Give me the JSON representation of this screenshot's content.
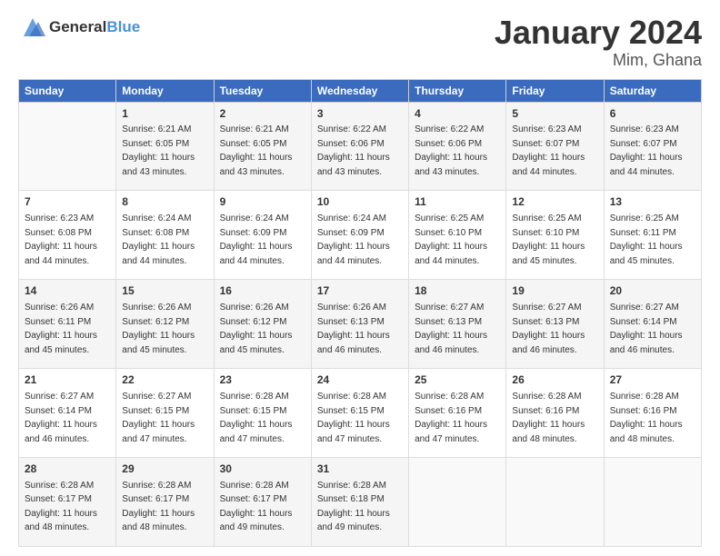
{
  "logo": {
    "general": "General",
    "blue": "Blue"
  },
  "title": "January 2024",
  "subtitle": "Mim, Ghana",
  "days_header": [
    "Sunday",
    "Monday",
    "Tuesday",
    "Wednesday",
    "Thursday",
    "Friday",
    "Saturday"
  ],
  "weeks": [
    [
      {
        "day": "",
        "info": ""
      },
      {
        "day": "1",
        "info": "Sunrise: 6:21 AM\nSunset: 6:05 PM\nDaylight: 11 hours\nand 43 minutes."
      },
      {
        "day": "2",
        "info": "Sunrise: 6:21 AM\nSunset: 6:05 PM\nDaylight: 11 hours\nand 43 minutes."
      },
      {
        "day": "3",
        "info": "Sunrise: 6:22 AM\nSunset: 6:06 PM\nDaylight: 11 hours\nand 43 minutes."
      },
      {
        "day": "4",
        "info": "Sunrise: 6:22 AM\nSunset: 6:06 PM\nDaylight: 11 hours\nand 43 minutes."
      },
      {
        "day": "5",
        "info": "Sunrise: 6:23 AM\nSunset: 6:07 PM\nDaylight: 11 hours\nand 44 minutes."
      },
      {
        "day": "6",
        "info": "Sunrise: 6:23 AM\nSunset: 6:07 PM\nDaylight: 11 hours\nand 44 minutes."
      }
    ],
    [
      {
        "day": "7",
        "info": "Sunrise: 6:23 AM\nSunset: 6:08 PM\nDaylight: 11 hours\nand 44 minutes."
      },
      {
        "day": "8",
        "info": "Sunrise: 6:24 AM\nSunset: 6:08 PM\nDaylight: 11 hours\nand 44 minutes."
      },
      {
        "day": "9",
        "info": "Sunrise: 6:24 AM\nSunset: 6:09 PM\nDaylight: 11 hours\nand 44 minutes."
      },
      {
        "day": "10",
        "info": "Sunrise: 6:24 AM\nSunset: 6:09 PM\nDaylight: 11 hours\nand 44 minutes."
      },
      {
        "day": "11",
        "info": "Sunrise: 6:25 AM\nSunset: 6:10 PM\nDaylight: 11 hours\nand 44 minutes."
      },
      {
        "day": "12",
        "info": "Sunrise: 6:25 AM\nSunset: 6:10 PM\nDaylight: 11 hours\nand 45 minutes."
      },
      {
        "day": "13",
        "info": "Sunrise: 6:25 AM\nSunset: 6:11 PM\nDaylight: 11 hours\nand 45 minutes."
      }
    ],
    [
      {
        "day": "14",
        "info": "Sunrise: 6:26 AM\nSunset: 6:11 PM\nDaylight: 11 hours\nand 45 minutes."
      },
      {
        "day": "15",
        "info": "Sunrise: 6:26 AM\nSunset: 6:12 PM\nDaylight: 11 hours\nand 45 minutes."
      },
      {
        "day": "16",
        "info": "Sunrise: 6:26 AM\nSunset: 6:12 PM\nDaylight: 11 hours\nand 45 minutes."
      },
      {
        "day": "17",
        "info": "Sunrise: 6:26 AM\nSunset: 6:13 PM\nDaylight: 11 hours\nand 46 minutes."
      },
      {
        "day": "18",
        "info": "Sunrise: 6:27 AM\nSunset: 6:13 PM\nDaylight: 11 hours\nand 46 minutes."
      },
      {
        "day": "19",
        "info": "Sunrise: 6:27 AM\nSunset: 6:13 PM\nDaylight: 11 hours\nand 46 minutes."
      },
      {
        "day": "20",
        "info": "Sunrise: 6:27 AM\nSunset: 6:14 PM\nDaylight: 11 hours\nand 46 minutes."
      }
    ],
    [
      {
        "day": "21",
        "info": "Sunrise: 6:27 AM\nSunset: 6:14 PM\nDaylight: 11 hours\nand 46 minutes."
      },
      {
        "day": "22",
        "info": "Sunrise: 6:27 AM\nSunset: 6:15 PM\nDaylight: 11 hours\nand 47 minutes."
      },
      {
        "day": "23",
        "info": "Sunrise: 6:28 AM\nSunset: 6:15 PM\nDaylight: 11 hours\nand 47 minutes."
      },
      {
        "day": "24",
        "info": "Sunrise: 6:28 AM\nSunset: 6:15 PM\nDaylight: 11 hours\nand 47 minutes."
      },
      {
        "day": "25",
        "info": "Sunrise: 6:28 AM\nSunset: 6:16 PM\nDaylight: 11 hours\nand 47 minutes."
      },
      {
        "day": "26",
        "info": "Sunrise: 6:28 AM\nSunset: 6:16 PM\nDaylight: 11 hours\nand 48 minutes."
      },
      {
        "day": "27",
        "info": "Sunrise: 6:28 AM\nSunset: 6:16 PM\nDaylight: 11 hours\nand 48 minutes."
      }
    ],
    [
      {
        "day": "28",
        "info": "Sunrise: 6:28 AM\nSunset: 6:17 PM\nDaylight: 11 hours\nand 48 minutes."
      },
      {
        "day": "29",
        "info": "Sunrise: 6:28 AM\nSunset: 6:17 PM\nDaylight: 11 hours\nand 48 minutes."
      },
      {
        "day": "30",
        "info": "Sunrise: 6:28 AM\nSunset: 6:17 PM\nDaylight: 11 hours\nand 49 minutes."
      },
      {
        "day": "31",
        "info": "Sunrise: 6:28 AM\nSunset: 6:18 PM\nDaylight: 11 hours\nand 49 minutes."
      },
      {
        "day": "",
        "info": ""
      },
      {
        "day": "",
        "info": ""
      },
      {
        "day": "",
        "info": ""
      }
    ]
  ]
}
